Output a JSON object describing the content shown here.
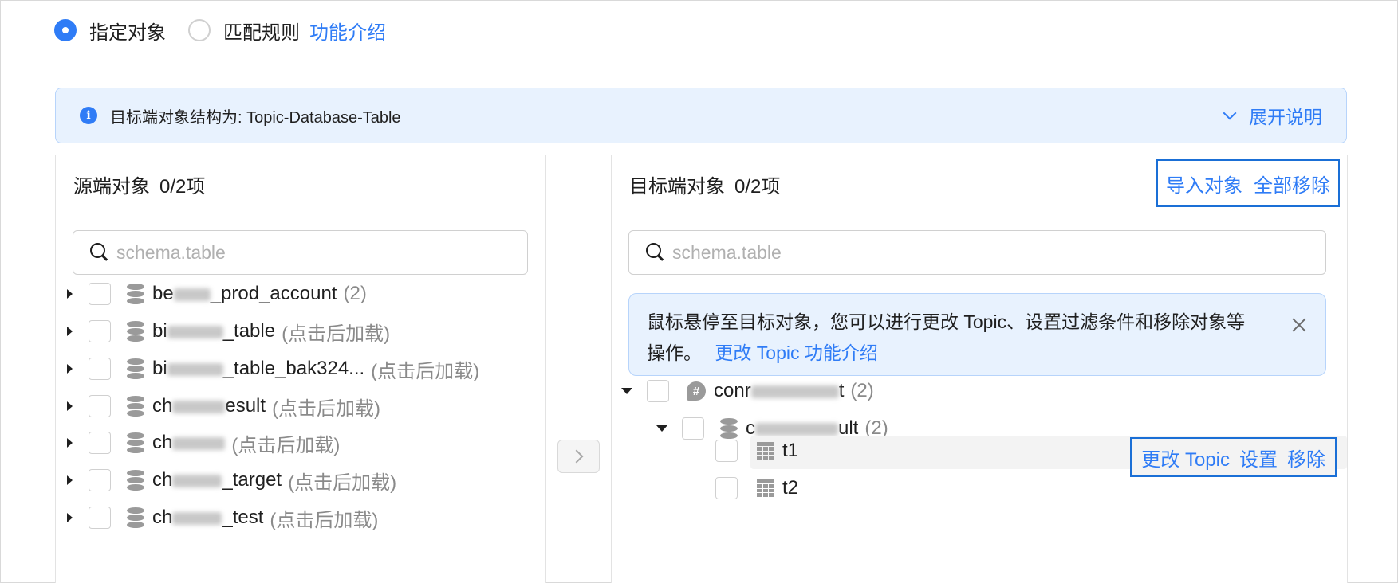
{
  "mode": {
    "options": [
      {
        "label": "指定对象",
        "checked": true
      },
      {
        "label": "匹配规则",
        "checked": false
      }
    ],
    "intro_link": "功能介绍"
  },
  "banner": {
    "text": "目标端对象结构为: Topic-Database-Table",
    "expand_label": "展开说明"
  },
  "source": {
    "title": "源端对象",
    "count": "0/2项",
    "search_placeholder": "schema.table",
    "items": [
      {
        "name_prefix": "be",
        "name_suffix": "_prod_account",
        "meta": "(2)"
      },
      {
        "name_prefix": "bi",
        "name_suffix": "_table",
        "meta": "(点击后加载)"
      },
      {
        "name_prefix": "bi",
        "name_suffix": "_table_bak324...",
        "meta": "(点击后加载)"
      },
      {
        "name_prefix": "ch",
        "name_suffix": "esult",
        "meta": "(点击后加载)"
      },
      {
        "name_prefix": "ch",
        "name_suffix": "",
        "meta": "(点击后加载)"
      },
      {
        "name_prefix": "ch",
        "name_suffix": "_target",
        "meta": "(点击后加载)"
      },
      {
        "name_prefix": "ch",
        "name_suffix": "_test",
        "meta": "(点击后加载)"
      }
    ]
  },
  "target": {
    "title": "目标端对象",
    "count": "0/2项",
    "import_label": "导入对象",
    "remove_all_label": "全部移除",
    "search_placeholder": "schema.table",
    "tip_text": "鼠标悬停至目标对象，您可以进行更改 Topic、设置过滤条件和移除对象等操作。",
    "tip_link": "更改 Topic 功能介绍",
    "topic": {
      "name_prefix": "conr",
      "name_suffix": "t",
      "meta": "(2)"
    },
    "database": {
      "name_prefix": "c",
      "name_suffix": "ult",
      "meta": "(2)"
    },
    "tables": [
      {
        "name": "t1"
      },
      {
        "name": "t2"
      }
    ],
    "row_actions": {
      "change_topic": "更改 Topic",
      "settings": "设置",
      "remove": "移除"
    }
  },
  "colors": {
    "accent": "#2f7cf6",
    "banner_bg": "#e8f2fe",
    "highlight_border": "#1a6fd6"
  }
}
